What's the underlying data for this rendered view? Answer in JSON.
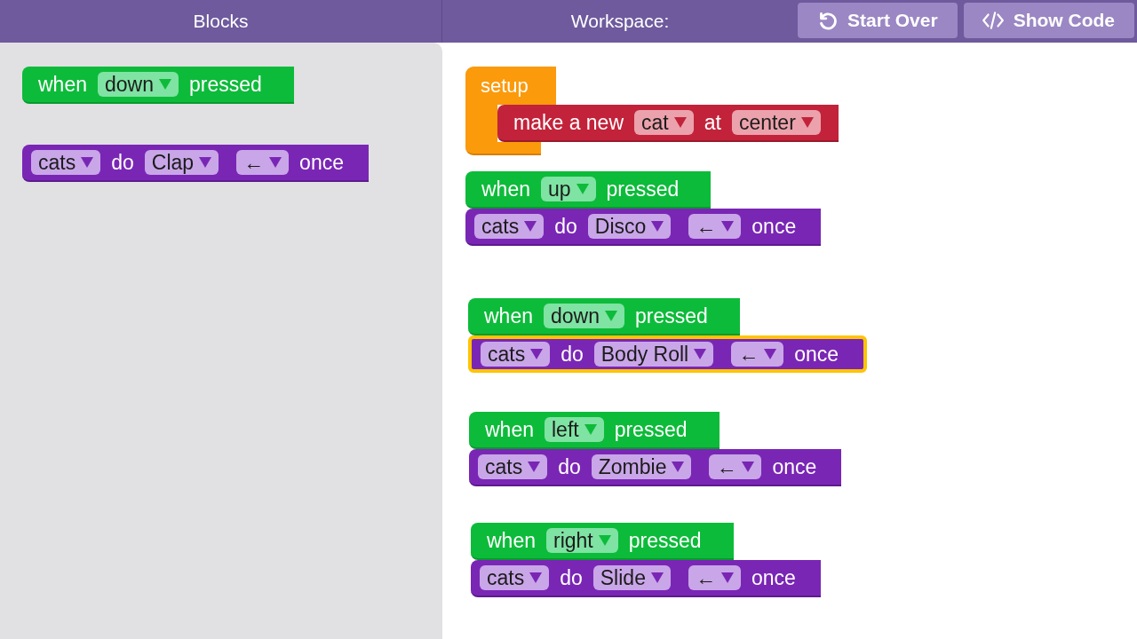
{
  "header": {
    "blocks_title": "Blocks",
    "workspace_title": "Workspace:",
    "buttons": [
      {
        "kind": "restart",
        "label": "Start Over"
      },
      {
        "kind": "code",
        "label": "Show Code"
      }
    ]
  },
  "toolbox": [
    {
      "kind": "event",
      "selected": false,
      "parts": [
        {
          "kind": "text",
          "text": "when"
        },
        {
          "kind": "dropdown",
          "text": "down"
        },
        {
          "kind": "text",
          "text": "pressed"
        }
      ]
    },
    {
      "kind": "action",
      "selected": false,
      "parts": [
        {
          "kind": "dropdown",
          "text": "cats"
        },
        {
          "kind": "text",
          "text": "do"
        },
        {
          "kind": "dropdown",
          "text": "Clap"
        },
        {
          "kind": "dropdown",
          "text": "←"
        },
        {
          "kind": "text",
          "text": "once"
        }
      ]
    }
  ],
  "workspace": [
    {
      "kind": "setup",
      "label": "setup",
      "selected": false,
      "body": {
        "kind": "create",
        "selected": false,
        "parts": [
          {
            "kind": "text",
            "text": "make a new"
          },
          {
            "kind": "dropdown",
            "text": "cat"
          },
          {
            "kind": "text",
            "text": "at"
          },
          {
            "kind": "dropdown",
            "text": "center"
          }
        ]
      }
    },
    {
      "kind": "event",
      "selected": false,
      "parts": [
        {
          "kind": "text",
          "text": "when"
        },
        {
          "kind": "dropdown",
          "text": "up"
        },
        {
          "kind": "text",
          "text": "pressed"
        }
      ],
      "next": {
        "kind": "action",
        "selected": false,
        "parts": [
          {
            "kind": "dropdown",
            "text": "cats"
          },
          {
            "kind": "text",
            "text": "do"
          },
          {
            "kind": "dropdown",
            "text": "Disco"
          },
          {
            "kind": "dropdown",
            "text": "←"
          },
          {
            "kind": "text",
            "text": "once"
          }
        ]
      }
    },
    {
      "kind": "event",
      "selected": false,
      "parts": [
        {
          "kind": "text",
          "text": "when"
        },
        {
          "kind": "dropdown",
          "text": "down"
        },
        {
          "kind": "text",
          "text": "pressed"
        }
      ],
      "next": {
        "kind": "action",
        "selected": true,
        "parts": [
          {
            "kind": "dropdown",
            "text": "cats"
          },
          {
            "kind": "text",
            "text": "do"
          },
          {
            "kind": "dropdown",
            "text": "Body Roll"
          },
          {
            "kind": "dropdown",
            "text": "←"
          },
          {
            "kind": "text",
            "text": "once"
          }
        ]
      }
    },
    {
      "kind": "event",
      "selected": false,
      "parts": [
        {
          "kind": "text",
          "text": "when"
        },
        {
          "kind": "dropdown",
          "text": "left"
        },
        {
          "kind": "text",
          "text": "pressed"
        }
      ],
      "next": {
        "kind": "action",
        "selected": false,
        "parts": [
          {
            "kind": "dropdown",
            "text": "cats"
          },
          {
            "kind": "text",
            "text": "do"
          },
          {
            "kind": "dropdown",
            "text": "Zombie"
          },
          {
            "kind": "dropdown",
            "text": "←"
          },
          {
            "kind": "text",
            "text": "once"
          }
        ]
      }
    },
    {
      "kind": "event",
      "selected": false,
      "parts": [
        {
          "kind": "text",
          "text": "when"
        },
        {
          "kind": "dropdown",
          "text": "right"
        },
        {
          "kind": "text",
          "text": "pressed"
        }
      ],
      "next": {
        "kind": "action",
        "selected": false,
        "parts": [
          {
            "kind": "dropdown",
            "text": "cats"
          },
          {
            "kind": "text",
            "text": "do"
          },
          {
            "kind": "dropdown",
            "text": "Slide"
          },
          {
            "kind": "dropdown",
            "text": "←"
          },
          {
            "kind": "text",
            "text": "once"
          }
        ]
      }
    }
  ]
}
